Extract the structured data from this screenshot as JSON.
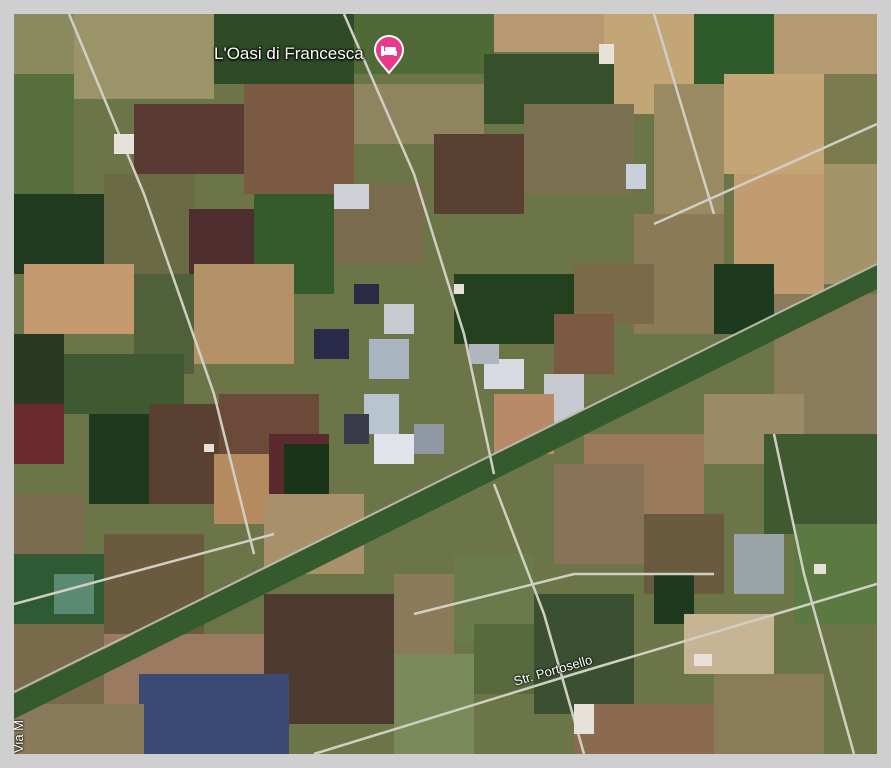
{
  "map": {
    "place_label": "L'Oasi di Francesca",
    "place_icon": "hotel-bed-icon",
    "pin_color": "#e8398b",
    "roads": [
      {
        "name": "Str. Portosello"
      },
      {
        "name": "Via M"
      }
    ]
  }
}
